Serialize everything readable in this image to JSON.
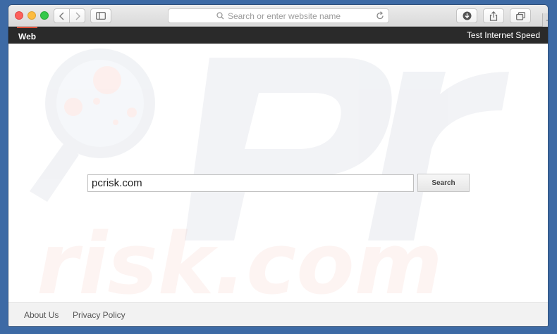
{
  "browser": {
    "address_placeholder": "Search or enter website name",
    "new_tab": "+"
  },
  "pagebar": {
    "web_tab": "Web",
    "speed_link": "Test Internet Speed"
  },
  "search": {
    "value": "pcrisk.com",
    "button_label": "Search"
  },
  "footer": {
    "about": "About Us",
    "privacy": "Privacy Policy"
  },
  "watermark": {
    "text": "risk.com"
  },
  "colors": {
    "desktop": "#3d6aa5",
    "pagebar": "#2a2a2a",
    "tab_accent": "#e2533a"
  }
}
